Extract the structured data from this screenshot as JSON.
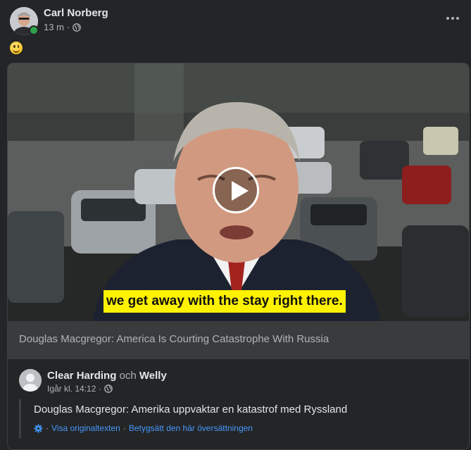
{
  "post": {
    "author": "Carl Norberg",
    "time": "13 m",
    "separator": "·",
    "emoji": "smiling-face",
    "more_icon": "more-horizontal-icon",
    "privacy_icon": "globe-icon"
  },
  "shared": {
    "video_caption": "we get away with the stay right there.",
    "link_title": "Douglas Macgregor: America Is Courting Catastrophe With Russia",
    "original_post": {
      "author": "Clear Harding",
      "conjunction": "och",
      "coauthor": "Welly",
      "time": "Igår kl. 14:12",
      "separator": "·",
      "text": "Douglas Macgregor: Amerika uppvaktar en katastrof med Ryssland",
      "translate_sep1": "·",
      "see_original": "Visa originaltexten",
      "translate_sep2": "·",
      "rate_translation": "Betygsätt den här översättningen"
    }
  },
  "colors": {
    "background": "#242526",
    "link_blue": "#4599ff",
    "online_green": "#31a24c",
    "caption_yellow": "#fff200"
  }
}
